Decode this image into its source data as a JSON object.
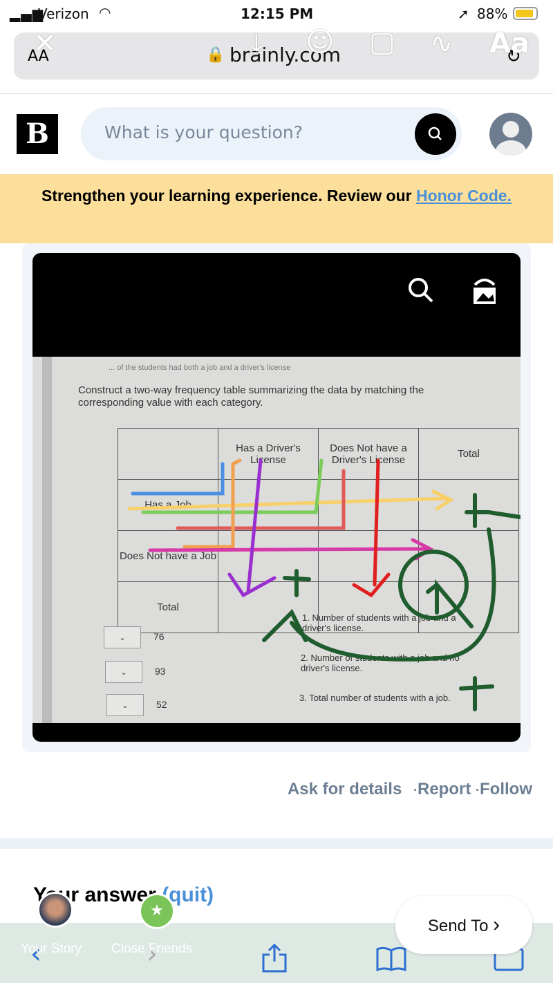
{
  "status_bar": {
    "carrier": "Verizon",
    "time": "12:15 PM",
    "battery": "88%"
  },
  "browser": {
    "text_size": "AA",
    "domain": "brainly.com"
  },
  "story_overlay": {
    "text_tool": "Aa",
    "icons": [
      "close-icon",
      "download-icon",
      "face-effects-icon",
      "sticker-icon",
      "draw-icon",
      "text-icon"
    ]
  },
  "header": {
    "logo": "B",
    "search_placeholder": "What is your question?"
  },
  "banner": {
    "text": "Strengthen your learning experience. Review our ",
    "link": "Honor Code."
  },
  "photo": {
    "cut_line": "... of the students had both a job and a driver's license",
    "instructions": "Construct a two-way frequency table summarizing the data by matching the corresponding value with each category.",
    "table": {
      "headers": [
        "",
        "Has a Driver's License",
        "Does Not have a Driver's License",
        "Total"
      ],
      "rows": [
        "Has a Job",
        "Does Not have a Job",
        "Total"
      ]
    },
    "dropdown_values": [
      "76",
      "93",
      "52"
    ],
    "items": [
      {
        "num": "1.",
        "text": "Number of students with a job and a driver's license."
      },
      {
        "num": "2.",
        "text": "Number of students with a job and no driver's license."
      },
      {
        "num": "3.",
        "text": "Total number of students with a job."
      }
    ]
  },
  "actions": {
    "ask": "Ask for details",
    "report": "Report",
    "follow": "Follow",
    "sep": "·"
  },
  "answer": {
    "title": "Your answer",
    "quit": "(quit)"
  },
  "story": {
    "your_story": "Your Story",
    "close_friends": "Close Friends",
    "send_to": "Send To"
  },
  "colors": {
    "banner": "#fbdf9b",
    "link": "#4a90d9",
    "accent_green": "#1f5c2e"
  }
}
